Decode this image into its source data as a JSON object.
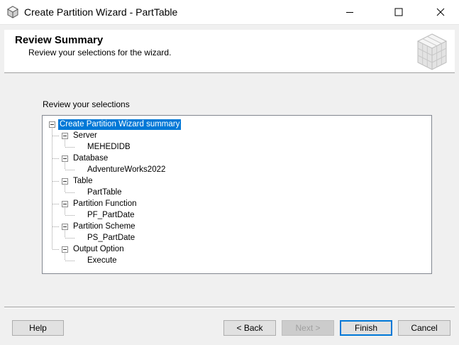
{
  "window": {
    "title": "Create Partition Wizard - PartTable",
    "controls": [
      "minimize-icon",
      "maximize-icon",
      "close-icon"
    ]
  },
  "header": {
    "title": "Review Summary",
    "subtitle": "Review your selections for the wizard.",
    "logo_icon": "cube-icon"
  },
  "main": {
    "section_label": "Review your selections",
    "tree": {
      "root": "Create Partition Wizard summary",
      "groups": [
        {
          "label": "Server",
          "value": "MEHEDIDB"
        },
        {
          "label": "Database",
          "value": "AdventureWorks2022"
        },
        {
          "label": "Table",
          "value": "PartTable"
        },
        {
          "label": "Partition Function",
          "value": "PF_PartDate"
        },
        {
          "label": "Partition Scheme",
          "value": "PS_PartDate"
        },
        {
          "label": "Output Option",
          "value": "Execute"
        }
      ]
    }
  },
  "footer": {
    "help": "Help",
    "back": "< Back",
    "next": "Next >",
    "finish": "Finish",
    "cancel": "Cancel"
  },
  "colors": {
    "selection": "#0078d7",
    "dialog_bg": "#f0f0f0"
  }
}
